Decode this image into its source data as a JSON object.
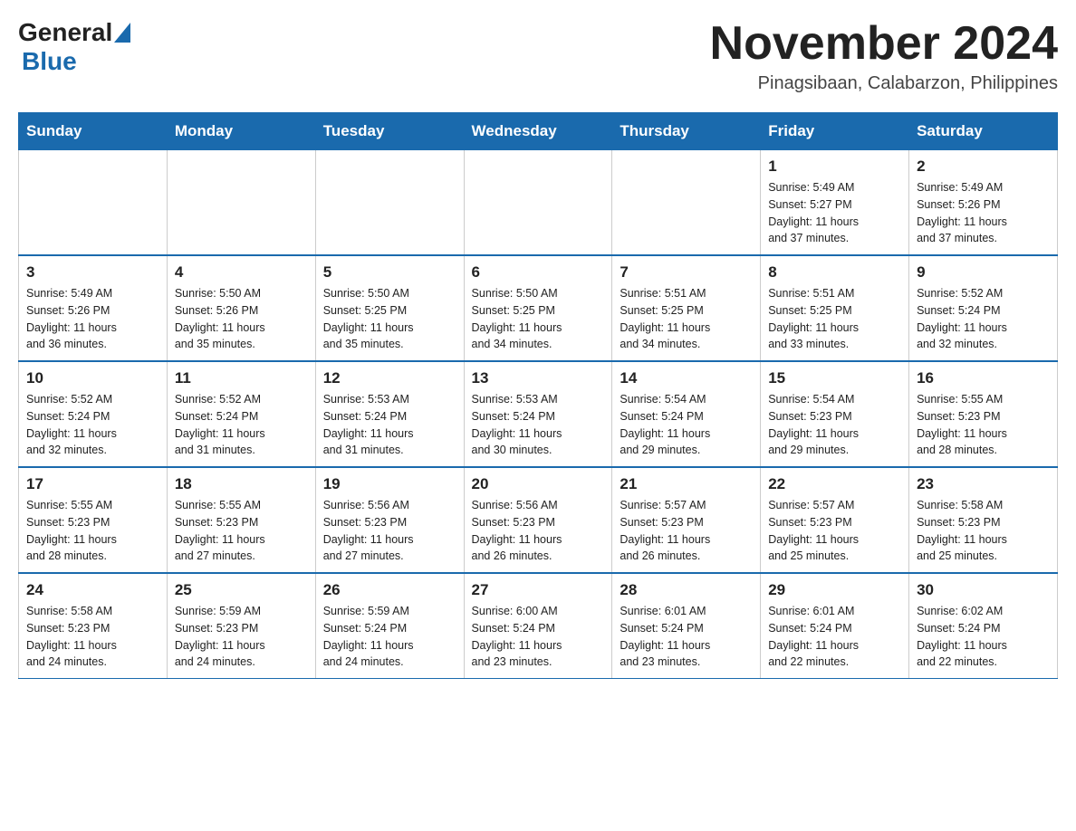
{
  "header": {
    "logo_general": "General",
    "logo_blue": "Blue",
    "month_title": "November 2024",
    "subtitle": "Pinagsibaan, Calabarzon, Philippines"
  },
  "days_of_week": [
    "Sunday",
    "Monday",
    "Tuesday",
    "Wednesday",
    "Thursday",
    "Friday",
    "Saturday"
  ],
  "weeks": [
    [
      {
        "day": "",
        "info": ""
      },
      {
        "day": "",
        "info": ""
      },
      {
        "day": "",
        "info": ""
      },
      {
        "day": "",
        "info": ""
      },
      {
        "day": "",
        "info": ""
      },
      {
        "day": "1",
        "info": "Sunrise: 5:49 AM\nSunset: 5:27 PM\nDaylight: 11 hours\nand 37 minutes."
      },
      {
        "day": "2",
        "info": "Sunrise: 5:49 AM\nSunset: 5:26 PM\nDaylight: 11 hours\nand 37 minutes."
      }
    ],
    [
      {
        "day": "3",
        "info": "Sunrise: 5:49 AM\nSunset: 5:26 PM\nDaylight: 11 hours\nand 36 minutes."
      },
      {
        "day": "4",
        "info": "Sunrise: 5:50 AM\nSunset: 5:26 PM\nDaylight: 11 hours\nand 35 minutes."
      },
      {
        "day": "5",
        "info": "Sunrise: 5:50 AM\nSunset: 5:25 PM\nDaylight: 11 hours\nand 35 minutes."
      },
      {
        "day": "6",
        "info": "Sunrise: 5:50 AM\nSunset: 5:25 PM\nDaylight: 11 hours\nand 34 minutes."
      },
      {
        "day": "7",
        "info": "Sunrise: 5:51 AM\nSunset: 5:25 PM\nDaylight: 11 hours\nand 34 minutes."
      },
      {
        "day": "8",
        "info": "Sunrise: 5:51 AM\nSunset: 5:25 PM\nDaylight: 11 hours\nand 33 minutes."
      },
      {
        "day": "9",
        "info": "Sunrise: 5:52 AM\nSunset: 5:24 PM\nDaylight: 11 hours\nand 32 minutes."
      }
    ],
    [
      {
        "day": "10",
        "info": "Sunrise: 5:52 AM\nSunset: 5:24 PM\nDaylight: 11 hours\nand 32 minutes."
      },
      {
        "day": "11",
        "info": "Sunrise: 5:52 AM\nSunset: 5:24 PM\nDaylight: 11 hours\nand 31 minutes."
      },
      {
        "day": "12",
        "info": "Sunrise: 5:53 AM\nSunset: 5:24 PM\nDaylight: 11 hours\nand 31 minutes."
      },
      {
        "day": "13",
        "info": "Sunrise: 5:53 AM\nSunset: 5:24 PM\nDaylight: 11 hours\nand 30 minutes."
      },
      {
        "day": "14",
        "info": "Sunrise: 5:54 AM\nSunset: 5:24 PM\nDaylight: 11 hours\nand 29 minutes."
      },
      {
        "day": "15",
        "info": "Sunrise: 5:54 AM\nSunset: 5:23 PM\nDaylight: 11 hours\nand 29 minutes."
      },
      {
        "day": "16",
        "info": "Sunrise: 5:55 AM\nSunset: 5:23 PM\nDaylight: 11 hours\nand 28 minutes."
      }
    ],
    [
      {
        "day": "17",
        "info": "Sunrise: 5:55 AM\nSunset: 5:23 PM\nDaylight: 11 hours\nand 28 minutes."
      },
      {
        "day": "18",
        "info": "Sunrise: 5:55 AM\nSunset: 5:23 PM\nDaylight: 11 hours\nand 27 minutes."
      },
      {
        "day": "19",
        "info": "Sunrise: 5:56 AM\nSunset: 5:23 PM\nDaylight: 11 hours\nand 27 minutes."
      },
      {
        "day": "20",
        "info": "Sunrise: 5:56 AM\nSunset: 5:23 PM\nDaylight: 11 hours\nand 26 minutes."
      },
      {
        "day": "21",
        "info": "Sunrise: 5:57 AM\nSunset: 5:23 PM\nDaylight: 11 hours\nand 26 minutes."
      },
      {
        "day": "22",
        "info": "Sunrise: 5:57 AM\nSunset: 5:23 PM\nDaylight: 11 hours\nand 25 minutes."
      },
      {
        "day": "23",
        "info": "Sunrise: 5:58 AM\nSunset: 5:23 PM\nDaylight: 11 hours\nand 25 minutes."
      }
    ],
    [
      {
        "day": "24",
        "info": "Sunrise: 5:58 AM\nSunset: 5:23 PM\nDaylight: 11 hours\nand 24 minutes."
      },
      {
        "day": "25",
        "info": "Sunrise: 5:59 AM\nSunset: 5:23 PM\nDaylight: 11 hours\nand 24 minutes."
      },
      {
        "day": "26",
        "info": "Sunrise: 5:59 AM\nSunset: 5:24 PM\nDaylight: 11 hours\nand 24 minutes."
      },
      {
        "day": "27",
        "info": "Sunrise: 6:00 AM\nSunset: 5:24 PM\nDaylight: 11 hours\nand 23 minutes."
      },
      {
        "day": "28",
        "info": "Sunrise: 6:01 AM\nSunset: 5:24 PM\nDaylight: 11 hours\nand 23 minutes."
      },
      {
        "day": "29",
        "info": "Sunrise: 6:01 AM\nSunset: 5:24 PM\nDaylight: 11 hours\nand 22 minutes."
      },
      {
        "day": "30",
        "info": "Sunrise: 6:02 AM\nSunset: 5:24 PM\nDaylight: 11 hours\nand 22 minutes."
      }
    ]
  ]
}
